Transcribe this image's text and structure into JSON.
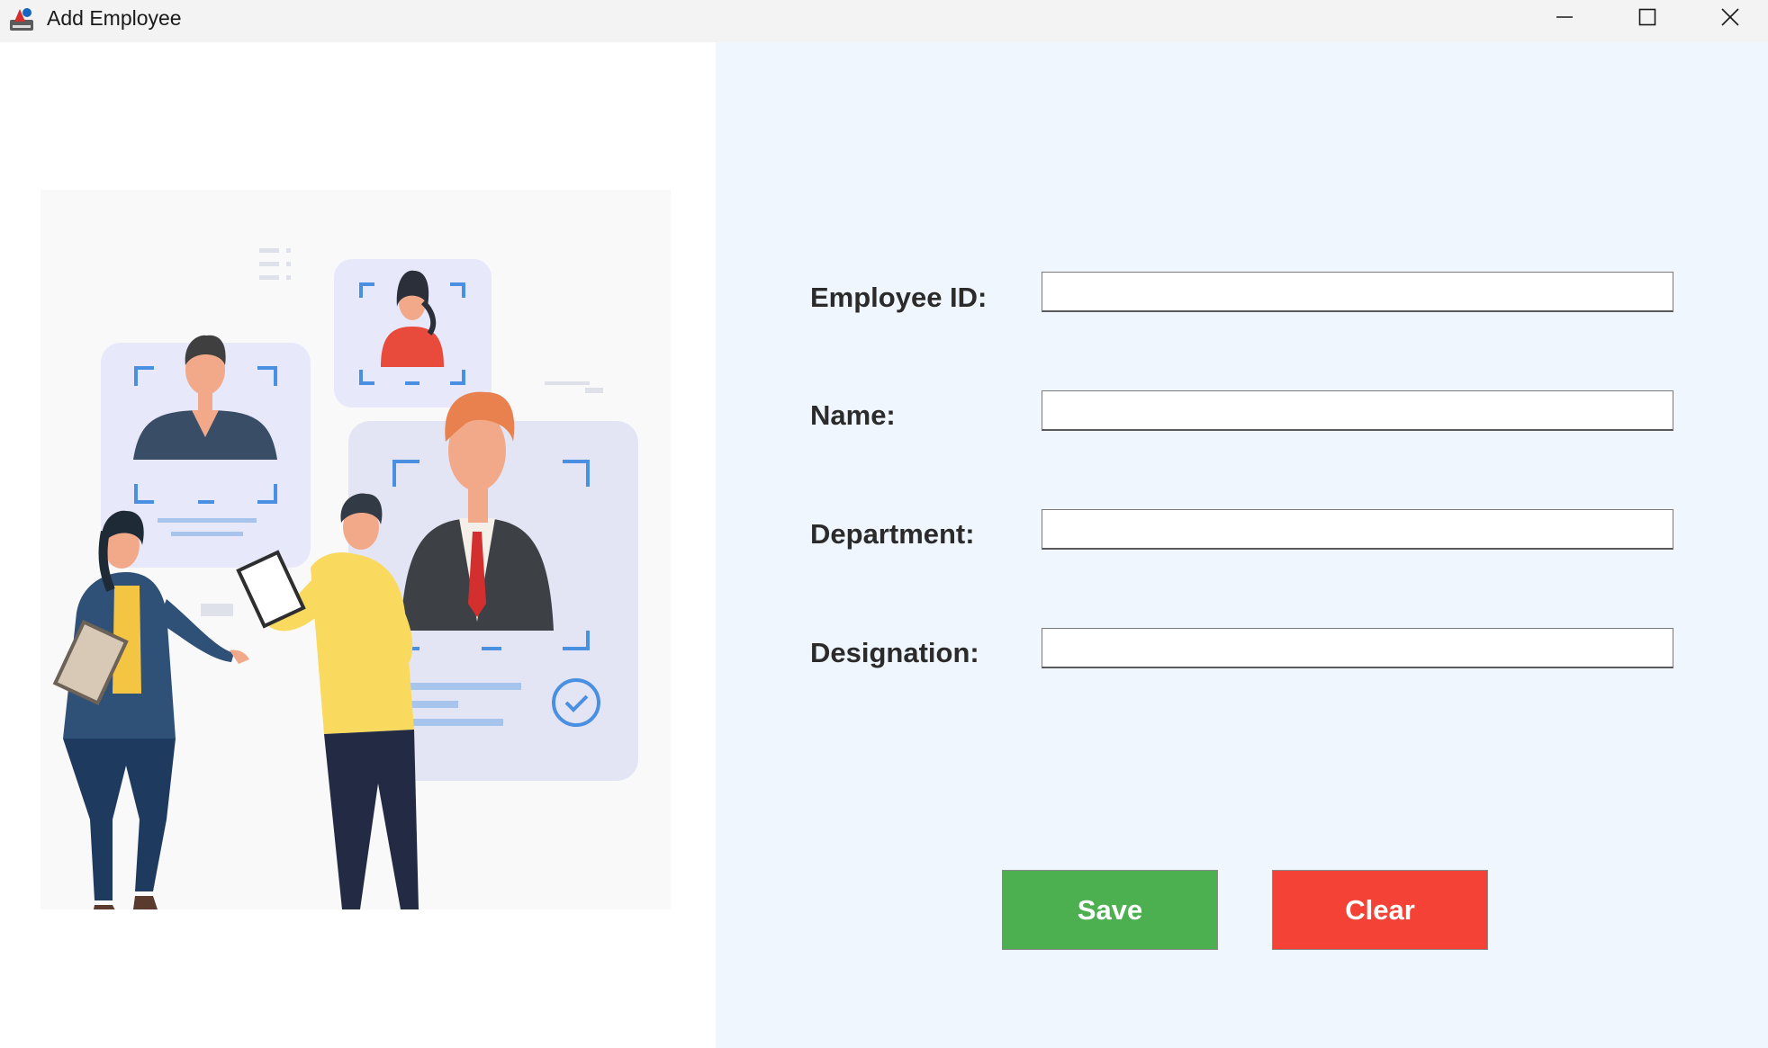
{
  "window": {
    "title": "Add Employee",
    "controls": {
      "minimize_icon": "minimize-icon",
      "maximize_icon": "maximize-icon",
      "close_icon": "close-icon"
    }
  },
  "illustration": {
    "icon": "employees-illustration"
  },
  "form": {
    "fields": [
      {
        "label": "Employee ID:",
        "value": ""
      },
      {
        "label": "Name:",
        "value": ""
      },
      {
        "label": "Department:",
        "value": ""
      },
      {
        "label": "Designation:",
        "value": ""
      }
    ]
  },
  "buttons": {
    "save_label": "Save",
    "clear_label": "Clear"
  },
  "colors": {
    "form_background": "#eff6fd",
    "titlebar_background": "#f3f3f3",
    "save_button": "#4caf50",
    "clear_button": "#f44336",
    "label_text": "#2b2b2b"
  }
}
